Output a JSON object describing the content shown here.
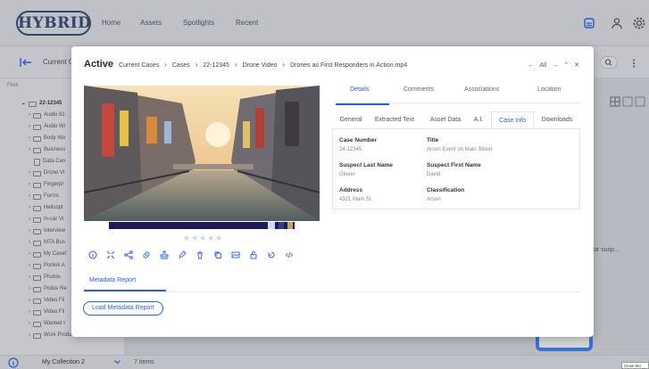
{
  "app": {
    "logo_text": "HYBRID",
    "nav": [
      "Home",
      "Assets",
      "Spotlights",
      "Recent"
    ]
  },
  "background": {
    "subbar_title": "Current Ca",
    "find_label": "Find",
    "tree": [
      {
        "label": "22-12345",
        "bold": true
      },
      {
        "label": "Audio 91"
      },
      {
        "label": "Audio Wi"
      },
      {
        "label": "Body Wo"
      },
      {
        "label": "Business"
      },
      {
        "label": "Data Cen"
      },
      {
        "label": "Drone Vi"
      },
      {
        "label": "Fingerpr"
      },
      {
        "label": "Forms"
      },
      {
        "label": "Helicopt"
      },
      {
        "label": "In-car Vi"
      },
      {
        "label": "Interview"
      },
      {
        "label": "MTA Bus"
      },
      {
        "label": "My Casef"
      },
      {
        "label": "Porlink A"
      },
      {
        "label": "Photos"
      },
      {
        "label": "Police Re"
      },
      {
        "label": "Video Fil"
      },
      {
        "label": "Video Fil"
      },
      {
        "label": "Wanted I"
      },
      {
        "label": "Work Product"
      }
    ],
    "right_peek_text": "or susp...",
    "collection_name": "My Collection 2",
    "collection_count": "7 items",
    "tooltip": "Close Mo"
  },
  "modal": {
    "status": "Active",
    "breadcrumb": [
      "Current Cases",
      "Cases",
      "22-12345",
      "Drone Video",
      "Drones as First Responders in Action.mp4"
    ],
    "nav_all": "All",
    "rating_stars": "★★★★★",
    "main_tabs": [
      {
        "label": "Details",
        "active": true
      },
      {
        "label": "Comments",
        "active": false
      },
      {
        "label": "Associations",
        "active": false
      },
      {
        "label": "Location",
        "active": false
      }
    ],
    "sub_tabs": [
      {
        "label": "General",
        "active": false
      },
      {
        "label": "Extracted Text",
        "active": false
      },
      {
        "label": "Asset Data",
        "active": false
      },
      {
        "label": "A.I.",
        "active": false
      },
      {
        "label": "Case Info",
        "active": true
      },
      {
        "label": "Downloads",
        "active": false
      }
    ],
    "case_info": [
      {
        "label": "Case Number",
        "value": "24-12345"
      },
      {
        "label": "Title",
        "value": "Arson Event on Main Street"
      },
      {
        "label": "Suspect Last Name",
        "value": "Glover"
      },
      {
        "label": "Suspect First Name",
        "value": "David"
      },
      {
        "label": "Address",
        "value": "4321 Main St."
      },
      {
        "label": "Classification",
        "value": "Arson"
      }
    ],
    "metadata_tab": "Metadata Report",
    "load_button": "Load Metadata Report",
    "toolbar_icons": [
      "info-icon",
      "expand-icon",
      "share-icon",
      "link-icon",
      "stamp-icon",
      "pen-icon",
      "trash-icon",
      "copy-icon",
      "image-icon",
      "lock-icon",
      "history-icon",
      "code-icon"
    ]
  },
  "colors": {
    "accent": "#2563eb",
    "logo": "#2c4a70"
  }
}
